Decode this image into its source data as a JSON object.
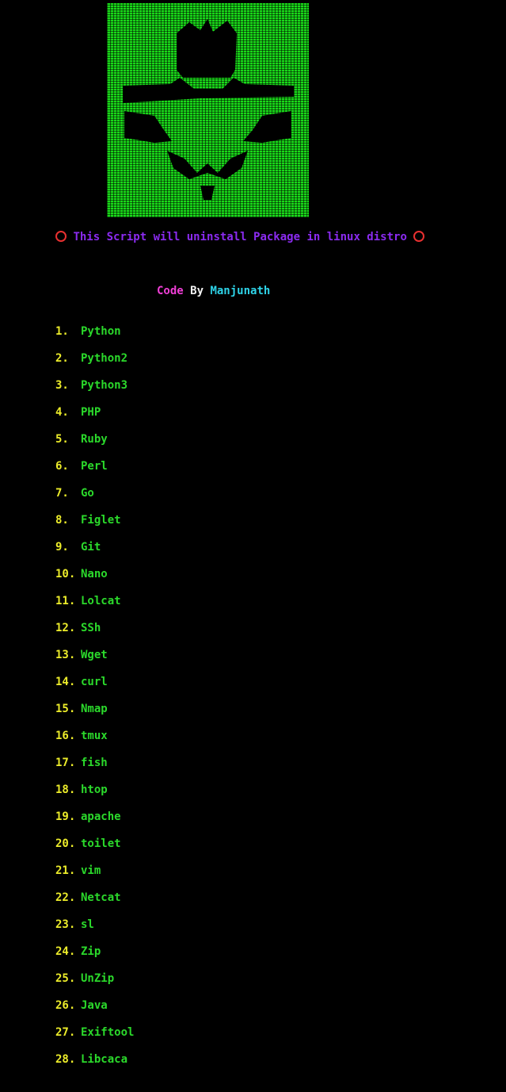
{
  "colors": {
    "background": "#000000",
    "art": "#19d919",
    "banner": "#8b2bf0",
    "ring": "#e83030",
    "code_word": "#f03fd7",
    "by_word": "#f2f2f2",
    "author": "#2ed3e8",
    "numbers": "#ecec2a",
    "packages": "#2bd92b"
  },
  "banner": {
    "icon_left": "red-circle-icon",
    "text": "This Script will uninstall Package in linux distro",
    "icon_right": "red-circle-icon"
  },
  "credit": {
    "code": "Code",
    "by": "By",
    "author": "Manjunath"
  },
  "menu": [
    {
      "num": "1.",
      "label": "Python"
    },
    {
      "num": "2.",
      "label": "Python2"
    },
    {
      "num": "3.",
      "label": "Python3"
    },
    {
      "num": "4.",
      "label": "PHP"
    },
    {
      "num": "5.",
      "label": "Ruby"
    },
    {
      "num": "6.",
      "label": "Perl"
    },
    {
      "num": "7.",
      "label": "Go"
    },
    {
      "num": "8.",
      "label": "Figlet"
    },
    {
      "num": "9.",
      "label": "Git"
    },
    {
      "num": "10.",
      "label": "Nano"
    },
    {
      "num": "11.",
      "label": "Lolcat"
    },
    {
      "num": "12.",
      "label": "SSh"
    },
    {
      "num": "13.",
      "label": "Wget"
    },
    {
      "num": "14.",
      "label": "curl"
    },
    {
      "num": "15.",
      "label": "Nmap"
    },
    {
      "num": "16.",
      "label": "tmux"
    },
    {
      "num": "17.",
      "label": "fish"
    },
    {
      "num": "18.",
      "label": "htop"
    },
    {
      "num": "19.",
      "label": "apache"
    },
    {
      "num": "20.",
      "label": "toilet"
    },
    {
      "num": "21.",
      "label": "vim"
    },
    {
      "num": "22.",
      "label": "Netcat"
    },
    {
      "num": "23.",
      "label": "sl"
    },
    {
      "num": "24.",
      "label": "Zip"
    },
    {
      "num": "25.",
      "label": "UnZip"
    },
    {
      "num": "26.",
      "label": "Java"
    },
    {
      "num": "27.",
      "label": "Exiftool"
    },
    {
      "num": "28.",
      "label": "Libcaca"
    }
  ]
}
